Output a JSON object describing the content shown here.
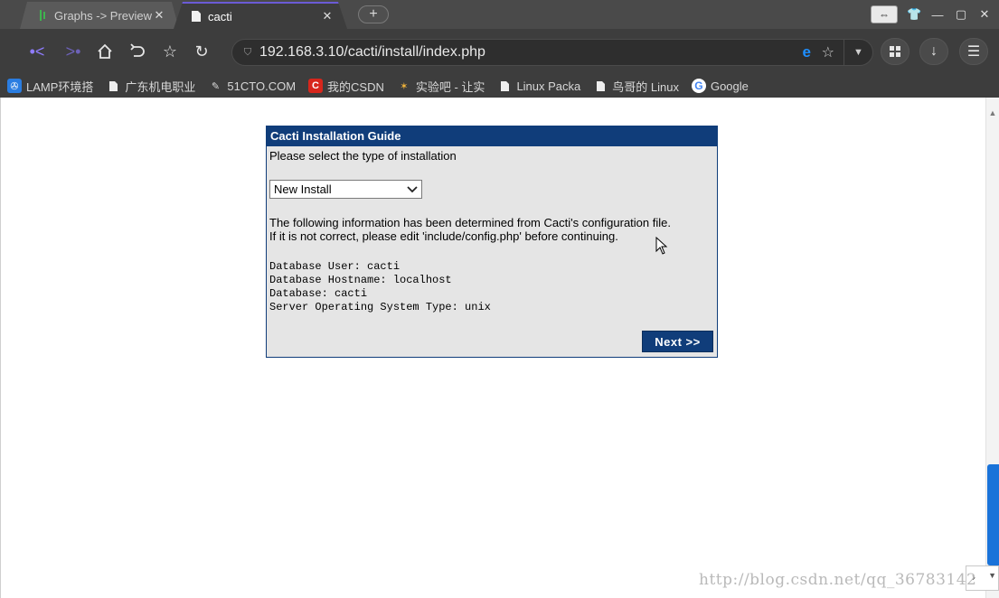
{
  "browser": {
    "tabs": [
      {
        "title": "Graphs -> Preview",
        "icon": "cacti-logo-icon",
        "active": false
      },
      {
        "title": "cacti",
        "icon": "page-icon",
        "active": true
      }
    ],
    "new_tab": "+",
    "address": {
      "url": "192.168.3.10/cacti/install/index.php"
    },
    "bookmarks": [
      {
        "label": "LAMP环境搭",
        "icon": "lamp-icon"
      },
      {
        "label": "广东机电职业",
        "icon": "page-icon"
      },
      {
        "label": "51CTO.COM",
        "icon": "51cto-icon"
      },
      {
        "label": "我的CSDN",
        "icon": "csdn-icon"
      },
      {
        "label": "实验吧 - 让实",
        "icon": "shiyanba-icon"
      },
      {
        "label": "Linux Packa",
        "icon": "page-icon"
      },
      {
        "label": "鸟哥的 Linux",
        "icon": "page-icon"
      },
      {
        "label": "Google",
        "icon": "google-icon"
      }
    ]
  },
  "page": {
    "panel": {
      "title": "Cacti Installation Guide",
      "prompt": "Please select the type of installation",
      "install_type": {
        "selected": "New Install"
      },
      "info_line1": "The following information has been determined from Cacti's configuration file.",
      "info_line2": "If it is not correct, please edit 'include/config.php' before continuing.",
      "config_lines": [
        "Database User: cacti",
        "Database Hostname: localhost",
        "Database: cacti",
        "Server Operating System Type: unix"
      ],
      "next_label": "Next >>"
    },
    "watermark": "http://blog.csdn.net/qq_36783142"
  },
  "colors": {
    "panel_header": "#103d7a",
    "panel_body": "#e5e5e5",
    "chrome_bg": "#3d3d3d",
    "accent_tab": "#6b5bd6"
  }
}
